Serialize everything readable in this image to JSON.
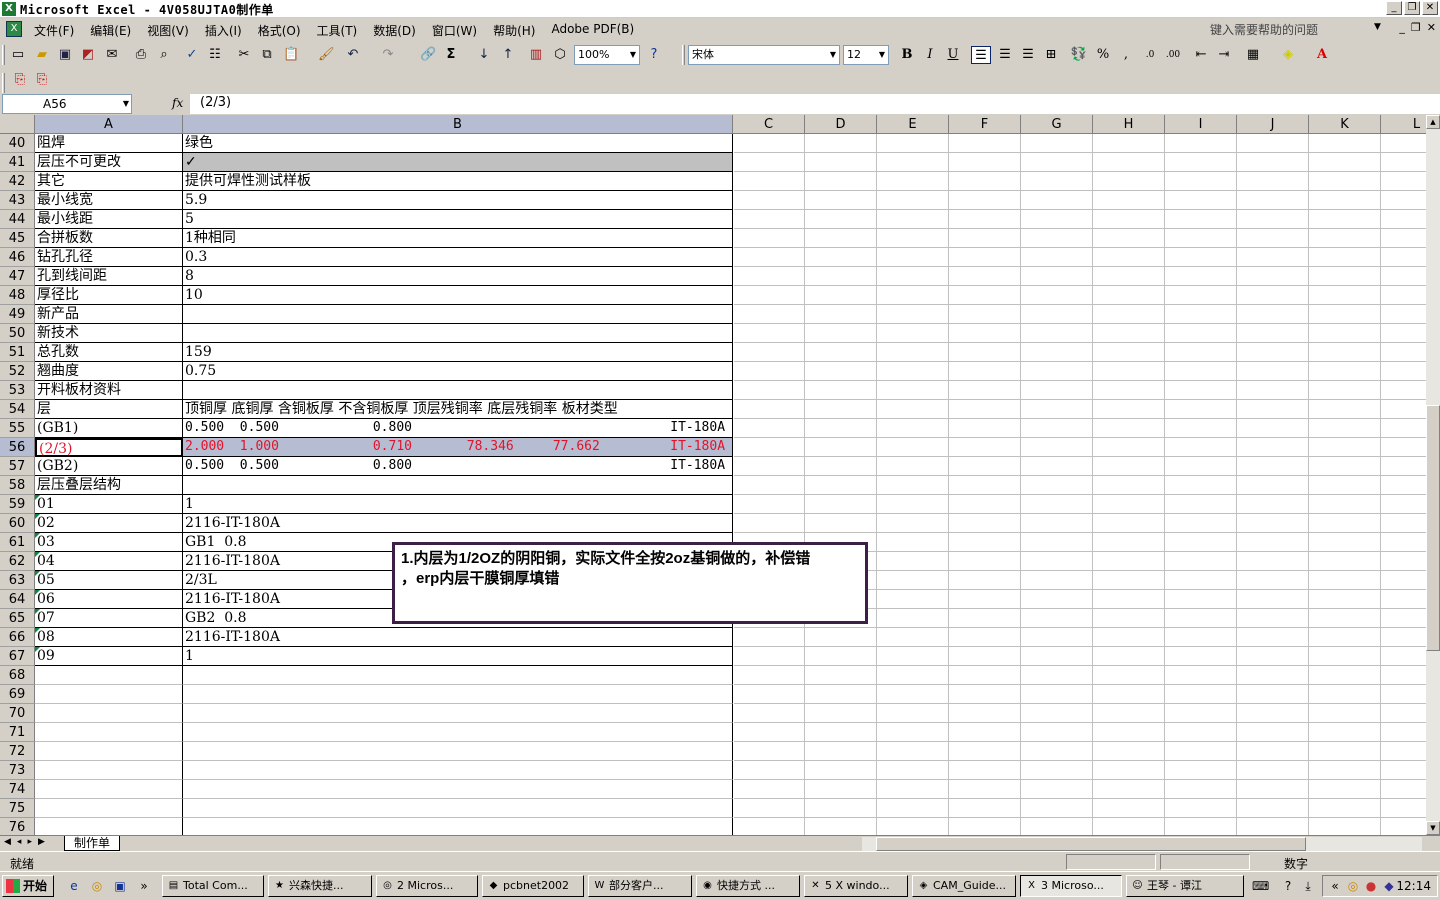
{
  "window": {
    "title": "Microsoft Excel - 4V058UJTA0制作单",
    "app_icon": "excel-icon"
  },
  "menu": {
    "items": [
      "文件(F)",
      "编辑(E)",
      "视图(V)",
      "插入(I)",
      "格式(O)",
      "工具(T)",
      "数据(D)",
      "窗口(W)",
      "帮助(H)",
      "Adobe PDF(B)"
    ],
    "help_placeholder": "键入需要帮助的问题"
  },
  "toolbar": {
    "zoom": "100%",
    "font_name": "宋体",
    "font_size": "12",
    "bold": "B",
    "italic": "I",
    "underline": "U",
    "percent": "%",
    "comma": ","
  },
  "formula_bar": {
    "name_box": "A56",
    "fx": "fx",
    "content": "(2/3)"
  },
  "columns": [
    "A",
    "B",
    "C",
    "D",
    "E",
    "F",
    "G",
    "H",
    "I",
    "J",
    "K",
    "L"
  ],
  "rows": [
    {
      "n": "40",
      "a": "阻焊",
      "b": "绿色"
    },
    {
      "n": "41",
      "a": "层压不可更改",
      "b": "✓"
    },
    {
      "n": "42",
      "a": "其它",
      "b": "提供可焊性测试样板"
    },
    {
      "n": "43",
      "a": "最小线宽",
      "b": "5.9"
    },
    {
      "n": "44",
      "a": "最小线距",
      "b": "5"
    },
    {
      "n": "45",
      "a": "合拼板数",
      "b": "1种相同"
    },
    {
      "n": "46",
      "a": "钻孔孔径",
      "b": "0.3"
    },
    {
      "n": "47",
      "a": "孔到线间距",
      "b": "8"
    },
    {
      "n": "48",
      "a": "厚径比",
      "b": "10"
    },
    {
      "n": "49",
      "a": "新产品",
      "b": ""
    },
    {
      "n": "50",
      "a": "新技术",
      "b": ""
    },
    {
      "n": "51",
      "a": "总孔数",
      "b": "159"
    },
    {
      "n": "52",
      "a": "翘曲度",
      "b": "0.75"
    },
    {
      "n": "53",
      "a": "开料板材资料",
      "b": ""
    },
    {
      "n": "54",
      "a": "层",
      "b": "顶铜厚 底铜厚 含铜板厚 不含铜板厚 顶层残铜率 底层残铜率 板材类型"
    },
    {
      "n": "55",
      "a": "(GB1)",
      "b": "0.500  0.500            0.800                                 IT-180A"
    },
    {
      "n": "56",
      "a": "(2/3)",
      "b": "2.000  1.000            0.710       78.346     77.662         IT-180A"
    },
    {
      "n": "57",
      "a": "(GB2)",
      "b": "0.500  0.500            0.800                                 IT-180A"
    },
    {
      "n": "58",
      "a": "层压叠层结构",
      "b": ""
    },
    {
      "n": "59",
      "a": "01",
      "b": "1"
    },
    {
      "n": "60",
      "a": "02",
      "b": "2116-IT-180A"
    },
    {
      "n": "61",
      "a": "03",
      "b": "GB1  0.8"
    },
    {
      "n": "62",
      "a": "04",
      "b": "2116-IT-180A"
    },
    {
      "n": "63",
      "a": "05",
      "b": "2/3L"
    },
    {
      "n": "64",
      "a": "06",
      "b": "2116-IT-180A"
    },
    {
      "n": "65",
      "a": "07",
      "b": "GB2  0.8"
    },
    {
      "n": "66",
      "a": "08",
      "b": "2116-IT-180A"
    },
    {
      "n": "67",
      "a": "09",
      "b": "1"
    },
    {
      "n": "68",
      "a": "",
      "b": ""
    },
    {
      "n": "69",
      "a": "",
      "b": ""
    },
    {
      "n": "70",
      "a": "",
      "b": ""
    },
    {
      "n": "71",
      "a": "",
      "b": ""
    },
    {
      "n": "72",
      "a": "",
      "b": ""
    },
    {
      "n": "73",
      "a": "",
      "b": ""
    },
    {
      "n": "74",
      "a": "",
      "b": ""
    },
    {
      "n": "75",
      "a": "",
      "b": ""
    },
    {
      "n": "76",
      "a": "",
      "b": ""
    }
  ],
  "comment": {
    "line1": "1.内层为1/2OZ的阴阳铜，实际文件全按2oz基铜做的，补偿错",
    "line2": "，erp内层干膜铜厚填错"
  },
  "sheet_tab": "制作单",
  "status": {
    "left": "就绪",
    "right": "数字"
  },
  "taskbar": {
    "start": "开始",
    "tasks": [
      {
        "label": "Total Com...",
        "icon": "floppy-icon"
      },
      {
        "label": "兴森快捷...",
        "icon": "star-icon"
      },
      {
        "label": "2 Micros...",
        "icon": "outlook-icon"
      },
      {
        "label": "pcbnet2002",
        "icon": "app-icon"
      },
      {
        "label": "部分客户...",
        "icon": "word-icon"
      },
      {
        "label": "快捷方式 ...",
        "icon": "globe-icon"
      },
      {
        "label": "5 X windo...",
        "icon": "x-icon"
      },
      {
        "label": "CAM_Guide...",
        "icon": "cam-icon"
      },
      {
        "label": "3 Microso...",
        "icon": "excel-icon"
      },
      {
        "label": "王琴 - 谭江",
        "icon": "user-icon"
      }
    ],
    "clock": "12:14"
  },
  "colors": {
    "red_text": "#e0142a",
    "selection": "#b6bdd2",
    "comment_border": "#3c1e46"
  }
}
